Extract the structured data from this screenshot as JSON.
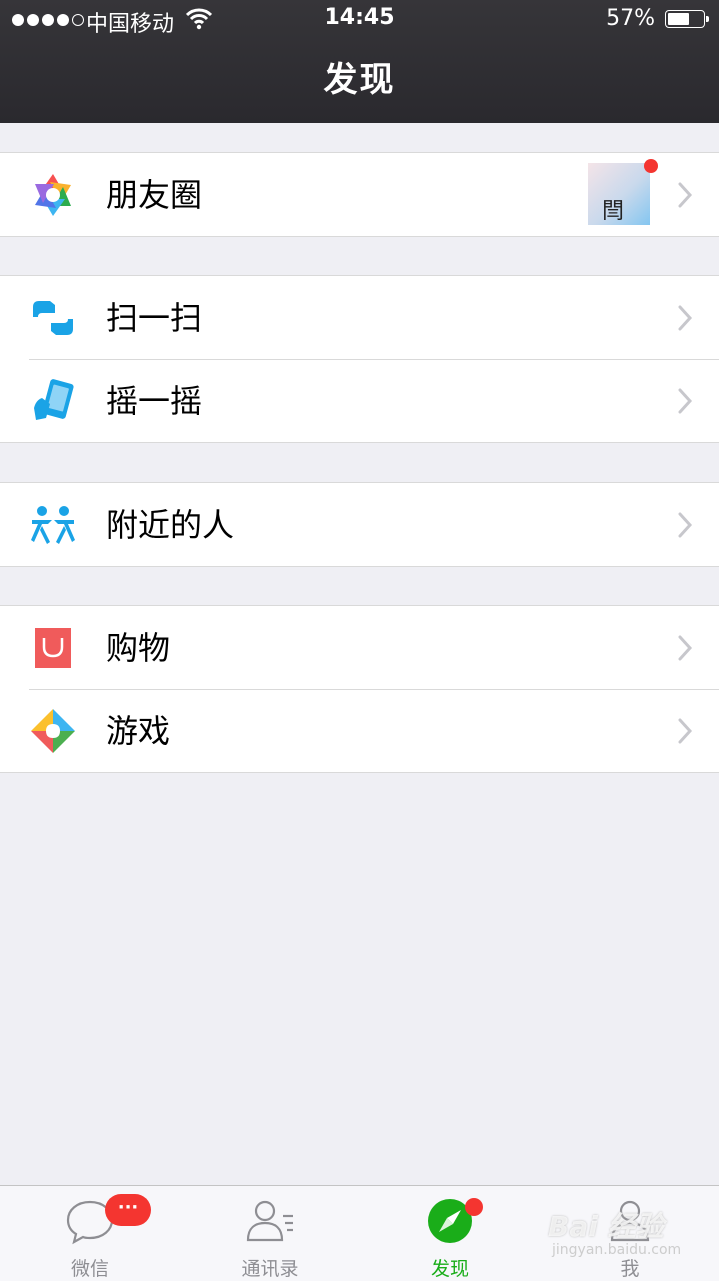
{
  "status_bar": {
    "carrier": "中国移动",
    "time": "14:45",
    "battery": "57%",
    "signal_bars": 4
  },
  "header": {
    "title": "发现"
  },
  "sections": [
    {
      "items": [
        {
          "label": "朋友圈",
          "icon": "moments-icon",
          "thumbnail_text": "閆",
          "has_new": true
        }
      ]
    },
    {
      "items": [
        {
          "label": "扫一扫",
          "icon": "scan-icon"
        },
        {
          "label": "摇一摇",
          "icon": "shake-icon"
        }
      ]
    },
    {
      "items": [
        {
          "label": "附近的人",
          "icon": "nearby-people-icon"
        }
      ]
    },
    {
      "items": [
        {
          "label": "购物",
          "icon": "shopping-icon"
        },
        {
          "label": "游戏",
          "icon": "games-icon"
        }
      ]
    }
  ],
  "tabbar": {
    "tabs": [
      {
        "label": "微信",
        "icon": "chat-bubble-icon",
        "badge": "···"
      },
      {
        "label": "通讯录",
        "icon": "contacts-icon"
      },
      {
        "label": "发现",
        "icon": "compass-icon",
        "active": true,
        "has_new": true
      },
      {
        "label": "我",
        "icon": "person-icon"
      }
    ]
  },
  "watermark": {
    "text": "Bai 经验",
    "sub": "jingyan.baidu.com"
  },
  "colors": {
    "header_bg": "#2b2a30",
    "accent_green": "#1aad19",
    "badge_red": "#f43530",
    "page_bg": "#efeff4"
  }
}
